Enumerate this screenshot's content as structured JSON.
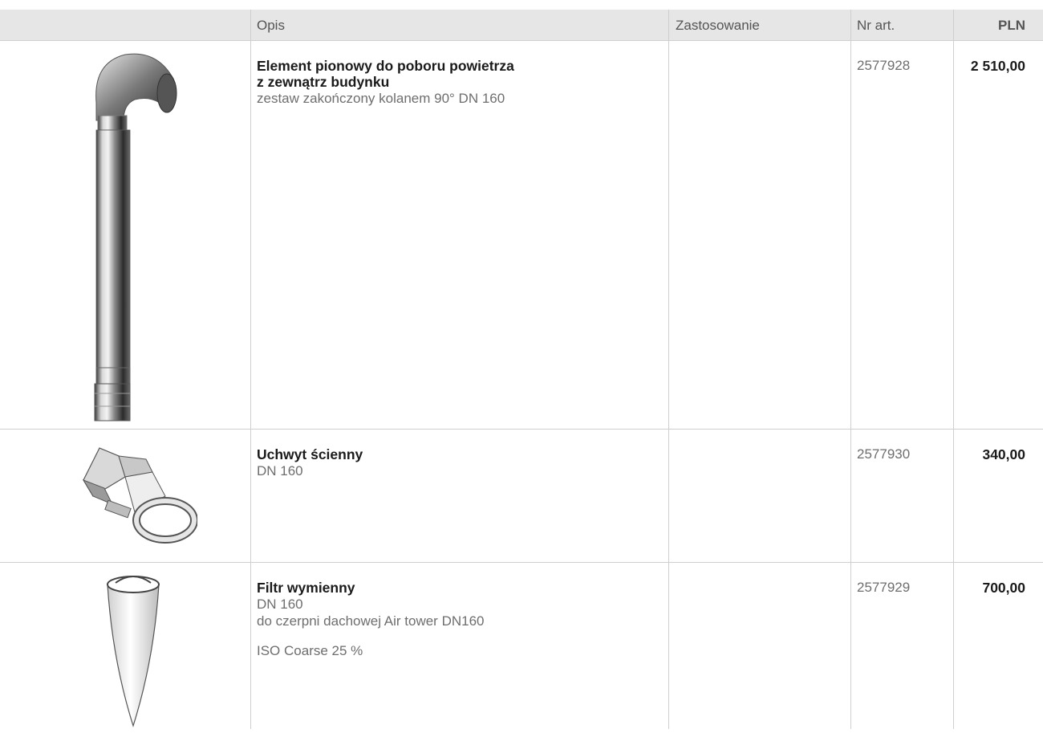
{
  "header": {
    "col_desc": "Opis",
    "col_usage": "Zastosowanie",
    "col_artno": "Nr art.",
    "col_price": "PLN"
  },
  "rows": [
    {
      "title_1": "Element pionowy do poboru powietrza",
      "title_2": "z zewnątrz budynku",
      "sub_1": "zestaw zakończony kolanem 90° DN 160",
      "artno": "2577928",
      "price": "2 510,00",
      "image_icon": "vertical-air-intake-pipe-icon"
    },
    {
      "title_1": "Uchwyt ścienny",
      "sub_1": "DN 160",
      "artno": "2577930",
      "price": "340,00",
      "image_icon": "wall-bracket-icon"
    },
    {
      "title_1": "Filtr wymienny",
      "sub_1": "DN 160",
      "sub_2": "do czerpni dachowej Air tower DN160",
      "sub_3": "ISO Coarse 25 %",
      "artno": "2577929",
      "price": "700,00",
      "image_icon": "replaceable-filter-icon"
    }
  ]
}
